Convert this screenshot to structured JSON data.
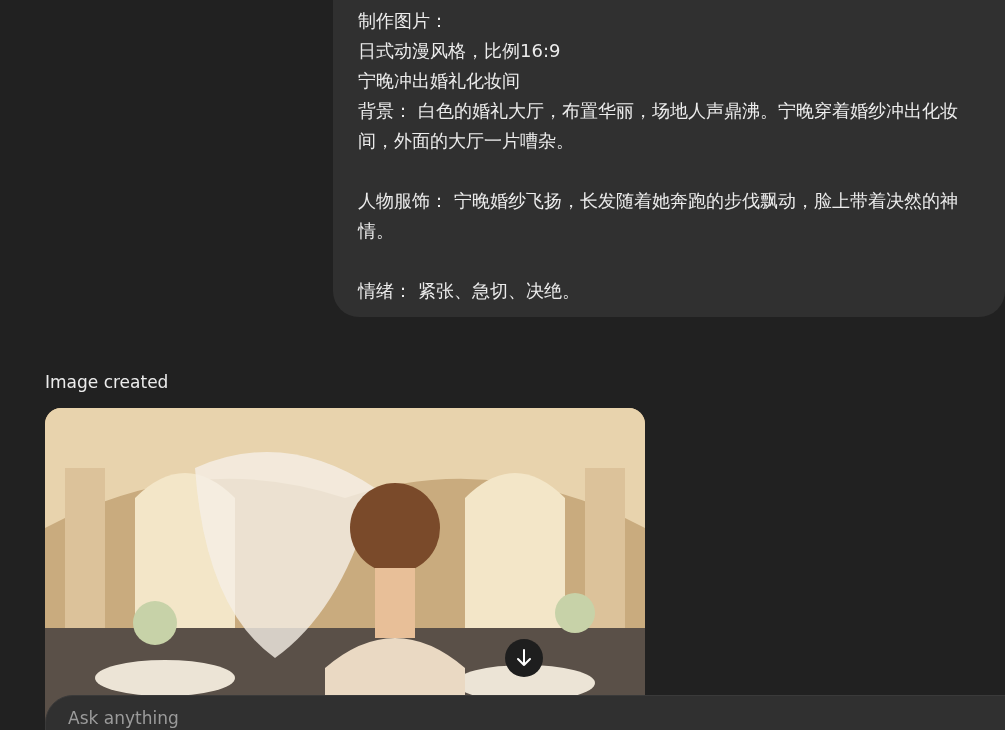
{
  "user_message": {
    "blocks": [
      {
        "paragraphs": [
          "制作图片：",
          "日式动漫风格，比例16:9",
          "宁晚冲出婚礼化妆间",
          "背景： 白色的婚礼大厅，布置华丽，场地人声鼎沸。宁晚穿着婚纱冲出化妆间，外面的大厅一片嘈杂。"
        ]
      },
      {
        "paragraphs": [
          "人物服饰： 宁晚婚纱飞扬，长发随着她奔跑的步伐飘动，脸上带着决然的神情。"
        ]
      },
      {
        "paragraphs": [
          "情绪： 紧张、急切、决绝。"
        ]
      }
    ]
  },
  "assistant_message": {
    "status": "Image created"
  },
  "composer": {
    "placeholder": "Ask anything"
  }
}
